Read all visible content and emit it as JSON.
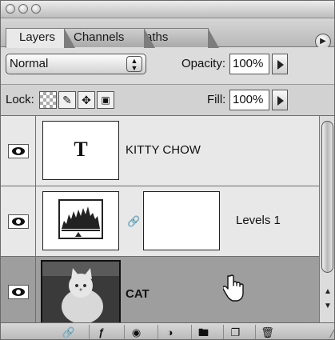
{
  "tabs": [
    {
      "label": "Layers",
      "active": true
    },
    {
      "label": "Channels",
      "active": false
    },
    {
      "label": "Paths",
      "active": false
    }
  ],
  "blend_mode": {
    "value": "Normal",
    "stepper_icon": "up-down-arrows-icon"
  },
  "opacity": {
    "label": "Opacity:",
    "value": "100%"
  },
  "lock": {
    "label": "Lock:",
    "icons": [
      "lock-transparent-pixels-icon",
      "lock-image-pixels-icon",
      "lock-position-icon",
      "lock-all-icon"
    ]
  },
  "fill": {
    "label": "Fill:",
    "value": "100%"
  },
  "layers": [
    {
      "name": "KITTY CHOW",
      "type": "text",
      "thumb_text": "T",
      "visible": true,
      "selected": false
    },
    {
      "name": "Levels 1",
      "type": "adjustment",
      "visible": true,
      "selected": false
    },
    {
      "name": "CAT",
      "type": "image",
      "visible": true,
      "selected": true
    }
  ],
  "bottom_icons": [
    "link-layers-icon",
    "layer-style-icon",
    "add-mask-icon",
    "adjustment-layer-icon",
    "new-group-icon",
    "new-layer-icon",
    "trash-icon"
  ],
  "colors": {
    "selected_row": "#9e9e9e",
    "panel": "#c8c8c8"
  }
}
